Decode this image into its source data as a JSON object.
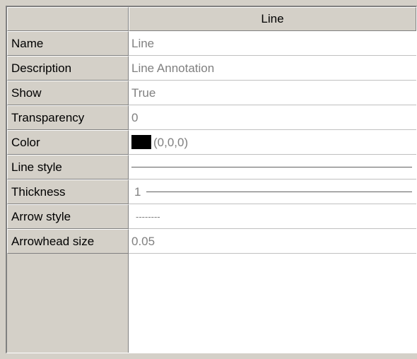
{
  "header": {
    "corner_label": "",
    "title": "Line"
  },
  "properties": [
    {
      "label": "Name",
      "value": "Line"
    },
    {
      "label": "Description",
      "value": "Line Annotation"
    },
    {
      "label": "Show",
      "value": "True"
    },
    {
      "label": "Transparency",
      "value": "0"
    },
    {
      "label": "Color",
      "value": "(0,0,0)",
      "swatch_color": "#000000"
    },
    {
      "label": "Line style",
      "value": ""
    },
    {
      "label": "Thickness",
      "value": "1"
    },
    {
      "label": "Arrow style",
      "value": "--------"
    },
    {
      "label": "Arrowhead size",
      "value": "0.05"
    }
  ]
}
